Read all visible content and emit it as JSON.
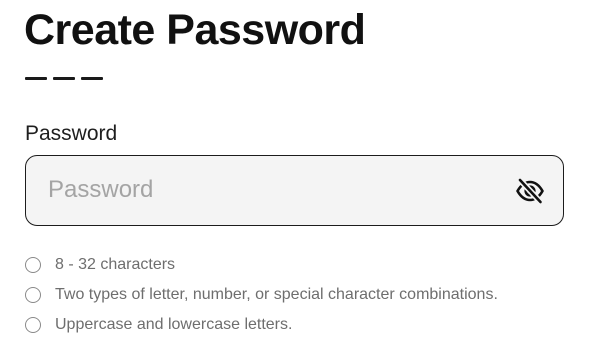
{
  "header": {
    "title": "Create Password"
  },
  "password_field": {
    "label": "Password",
    "placeholder": "Password",
    "value": "",
    "toggle_icon": "eye-off-icon"
  },
  "requirements": [
    {
      "text": "8 - 32 characters",
      "met": false
    },
    {
      "text": "Two types of letter, number, or special character combinations.",
      "met": false
    },
    {
      "text": "Uppercase and lowercase letters.",
      "met": false
    }
  ]
}
